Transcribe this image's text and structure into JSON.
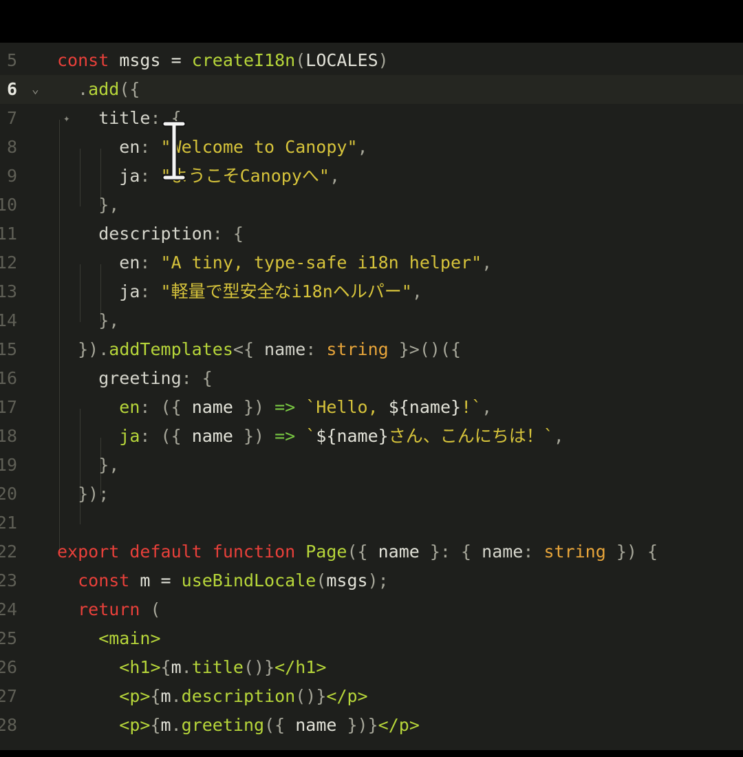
{
  "editor": {
    "current_line": 6,
    "lines": [
      {
        "n": "5",
        "tokens": [
          [
            "kw",
            "const"
          ],
          [
            "id",
            " msgs = "
          ],
          [
            "fn",
            "createI18n"
          ],
          [
            "pn",
            "("
          ],
          [
            "id",
            "LOCALES"
          ],
          [
            "pn",
            ")"
          ]
        ]
      },
      {
        "n": "6",
        "tokens": [
          [
            "pn",
            "  ."
          ],
          [
            "fn",
            "add"
          ],
          [
            "pn",
            "({"
          ]
        ]
      },
      {
        "n": "7",
        "tokens": [
          [
            "prop",
            "    title"
          ],
          [
            "pn",
            ": {"
          ]
        ]
      },
      {
        "n": "8",
        "tokens": [
          [
            "prop",
            "      en"
          ],
          [
            "pn",
            ": "
          ],
          [
            "str",
            "\"Welcome to Canopy\""
          ],
          [
            "pn",
            ","
          ]
        ]
      },
      {
        "n": "9",
        "tokens": [
          [
            "prop",
            "      ja"
          ],
          [
            "pn",
            ": "
          ],
          [
            "str",
            "\"ようこそCanopyへ\""
          ],
          [
            "pn",
            ","
          ]
        ]
      },
      {
        "n": "10",
        "tokens": [
          [
            "pn",
            "    },"
          ]
        ]
      },
      {
        "n": "11",
        "tokens": [
          [
            "prop",
            "    description"
          ],
          [
            "pn",
            ": {"
          ]
        ]
      },
      {
        "n": "12",
        "tokens": [
          [
            "prop",
            "      en"
          ],
          [
            "pn",
            ": "
          ],
          [
            "str",
            "\"A tiny, type-safe i18n helper\""
          ],
          [
            "pn",
            ","
          ]
        ]
      },
      {
        "n": "13",
        "tokens": [
          [
            "prop",
            "      ja"
          ],
          [
            "pn",
            ": "
          ],
          [
            "str",
            "\"軽量で型安全なi18nヘルパー\""
          ],
          [
            "pn",
            ","
          ]
        ]
      },
      {
        "n": "14",
        "tokens": [
          [
            "pn",
            "    },"
          ]
        ]
      },
      {
        "n": "15",
        "tokens": [
          [
            "pn",
            "  })."
          ],
          [
            "fn",
            "addTemplates"
          ],
          [
            "pn",
            "<{ "
          ],
          [
            "prop",
            "name"
          ],
          [
            "pn",
            ": "
          ],
          [
            "ty",
            "string"
          ],
          [
            "pn",
            " }>()({"
          ]
        ]
      },
      {
        "n": "16",
        "tokens": [
          [
            "prop",
            "    greeting"
          ],
          [
            "pn",
            ": {"
          ]
        ]
      },
      {
        "n": "17",
        "tokens": [
          [
            "fn",
            "      en"
          ],
          [
            "pn",
            ": ({ "
          ],
          [
            "id",
            "name"
          ],
          [
            "pn",
            " }) "
          ],
          [
            "arr",
            "=>"
          ],
          [
            "str",
            " `Hello, "
          ],
          [
            "id",
            "${name}"
          ],
          [
            "str",
            "!`"
          ],
          [
            "pn",
            ","
          ]
        ]
      },
      {
        "n": "18",
        "tokens": [
          [
            "fn",
            "      ja"
          ],
          [
            "pn",
            ": ({ "
          ],
          [
            "id",
            "name"
          ],
          [
            "pn",
            " }) "
          ],
          [
            "arr",
            "=>"
          ],
          [
            "str",
            " `"
          ],
          [
            "id",
            "${name}"
          ],
          [
            "str",
            "さん、こんにちは！`"
          ],
          [
            "pn",
            ","
          ]
        ]
      },
      {
        "n": "19",
        "tokens": [
          [
            "pn",
            "    },"
          ]
        ]
      },
      {
        "n": "20",
        "tokens": [
          [
            "pn",
            "  });"
          ]
        ]
      },
      {
        "n": "21",
        "tokens": []
      },
      {
        "n": "22",
        "tokens": [
          [
            "kw",
            "export default function "
          ],
          [
            "fn",
            "Page"
          ],
          [
            "pn",
            "({ "
          ],
          [
            "id",
            "name"
          ],
          [
            "pn",
            " }: { "
          ],
          [
            "prop",
            "name"
          ],
          [
            "pn",
            ": "
          ],
          [
            "ty",
            "string"
          ],
          [
            "pn",
            " }) {"
          ]
        ]
      },
      {
        "n": "23",
        "tokens": [
          [
            "kw",
            "  const "
          ],
          [
            "id",
            "m = "
          ],
          [
            "fn",
            "useBindLocale"
          ],
          [
            "pn",
            "("
          ],
          [
            "id",
            "msgs"
          ],
          [
            "pn",
            ");"
          ]
        ]
      },
      {
        "n": "24",
        "tokens": [
          [
            "kw",
            "  return "
          ],
          [
            "pn",
            "("
          ]
        ]
      },
      {
        "n": "25",
        "tokens": [
          [
            "tag",
            "    <main>"
          ]
        ]
      },
      {
        "n": "26",
        "tokens": [
          [
            "tag",
            "      <h1>"
          ],
          [
            "pn",
            "{"
          ],
          [
            "id",
            "m"
          ],
          [
            "pn",
            "."
          ],
          [
            "fn",
            "title"
          ],
          [
            "pn",
            "()}"
          ],
          [
            "tag",
            "</h1>"
          ]
        ]
      },
      {
        "n": "27",
        "tokens": [
          [
            "tag",
            "      <p>"
          ],
          [
            "pn",
            "{"
          ],
          [
            "id",
            "m"
          ],
          [
            "pn",
            "."
          ],
          [
            "fn",
            "description"
          ],
          [
            "pn",
            "()}"
          ],
          [
            "tag",
            "</p>"
          ]
        ]
      },
      {
        "n": "28",
        "tokens": [
          [
            "tag",
            "      <p>"
          ],
          [
            "pn",
            "{"
          ],
          [
            "id",
            "m"
          ],
          [
            "pn",
            "."
          ],
          [
            "fn",
            "greeting"
          ],
          [
            "pn",
            "({ "
          ],
          [
            "id",
            "name"
          ],
          [
            "pn",
            " })}"
          ],
          [
            "tag",
            "</p>"
          ]
        ]
      }
    ]
  },
  "icons": {
    "fold": "chevron-down-icon",
    "cursor": "text-cursor-icon",
    "gutter_marker": "sparkle-icon"
  },
  "colors": {
    "background": "#1e1f1c",
    "keyword": "#e8403a",
    "function": "#b7d63a",
    "string": "#d6c33b",
    "type": "#e8a53a"
  }
}
